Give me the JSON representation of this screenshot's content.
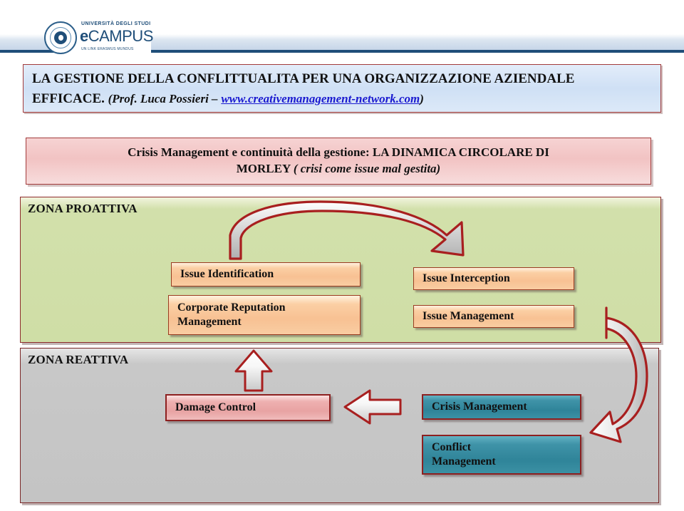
{
  "header": {
    "logo": {
      "name": "ecampus-logo",
      "top_line": "UNIVERSITÀ DEGLI STUDI",
      "main_e": "e",
      "main_text": "CAMPUS",
      "sub_line": "UN LINK ERASMUS MUNDUS"
    }
  },
  "title": {
    "line1": "LA GESTIONE DELLA CONFLITTUALITA PER UNA ORGANIZZAZIONE AZIENDALE",
    "line2_main": "EFFICACE.",
    "line2_author": "(Prof. Luca Possieri –",
    "line2_link": "www.creativemanagement-network.com",
    "line2_close": ")"
  },
  "subtitle": {
    "line1": "Crisis Management e continuità della gestione: LA DINAMICA CIRCOLARE DI",
    "line2_main": "MORLEY",
    "line2_italic": "( crisi come issue mal gestita)"
  },
  "zones": {
    "proactive": {
      "label": "ZONA PROATTIVA"
    },
    "reactive": {
      "label": "ZONA REATTIVA"
    }
  },
  "boxes": {
    "issue_identification": "Issue Identification",
    "corporate_reputation_management_l1": "Corporate Reputation",
    "corporate_reputation_management_l2": "Management",
    "issue_interception": "Issue Interception",
    "issue_management": "Issue Management",
    "damage_control": "Damage Control",
    "crisis_management": "Crisis Management",
    "conflict_management_l1": "Conflict",
    "conflict_management_l2": "Management"
  },
  "arrows": {
    "top_curve": "curved-arrow-right-icon",
    "right_curve": "curved-arrow-down-icon",
    "left_straight": "arrow-left-icon",
    "up_straight": "arrow-up-icon"
  },
  "colors": {
    "accent_red": "#8d2b2b",
    "zone_proactive": "#cfdea6",
    "zone_reactive": "#c4c4c4",
    "box_orange": "#f8c193",
    "box_pink": "#e8a3a3",
    "box_teal": "#2f8499",
    "title_blue": "#cfe0f5",
    "subtitle_pink": "#f2c3c3",
    "logo_navy": "#1f4e79"
  }
}
